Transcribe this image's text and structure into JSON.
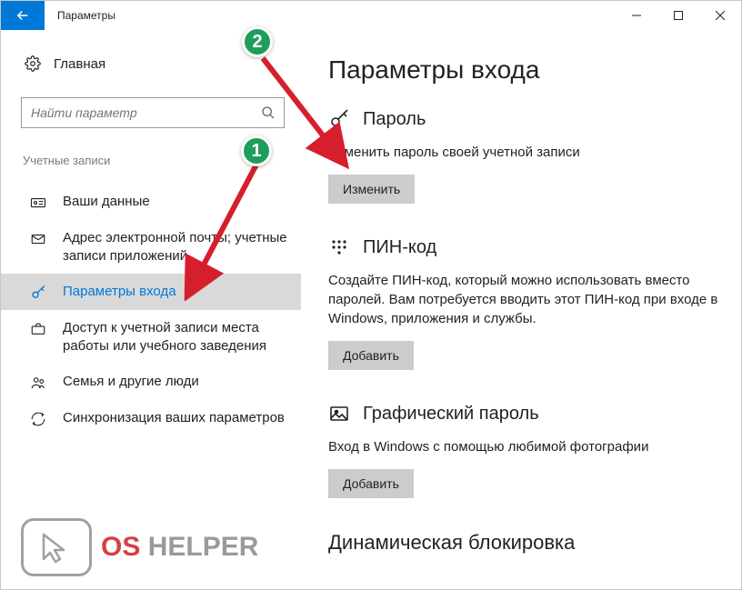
{
  "window": {
    "title": "Параметры"
  },
  "sidebar": {
    "home_label": "Главная",
    "search_placeholder": "Найти параметр",
    "section_label": "Учетные записи",
    "items": [
      {
        "label": "Ваши данные"
      },
      {
        "label": "Адрес электронной почты; учетные записи приложений"
      },
      {
        "label": "Параметры входа"
      },
      {
        "label": "Доступ к учетной записи места работы или учебного заведения"
      },
      {
        "label": "Семья и другие люди"
      },
      {
        "label": "Синхронизация ваших параметров"
      }
    ]
  },
  "main": {
    "title": "Параметры входа",
    "sections": [
      {
        "heading": "Пароль",
        "desc": "Изменить пароль своей учетной записи",
        "button": "Изменить"
      },
      {
        "heading": "ПИН-код",
        "desc": "Создайте ПИН-код, который можно использовать вместо паролей. Вам потребуется вводить этот ПИН-код при входе в Windows, приложения и службы.",
        "button": "Добавить"
      },
      {
        "heading": "Графический пароль",
        "desc": "Вход в Windows с помощью любимой фотографии",
        "button": "Добавить"
      },
      {
        "heading": "Динамическая блокировка",
        "desc": "",
        "button": ""
      }
    ]
  },
  "annotations": {
    "badge1": "1",
    "badge2": "2"
  },
  "logo": {
    "os": "OS",
    "helper": " HELPER"
  }
}
